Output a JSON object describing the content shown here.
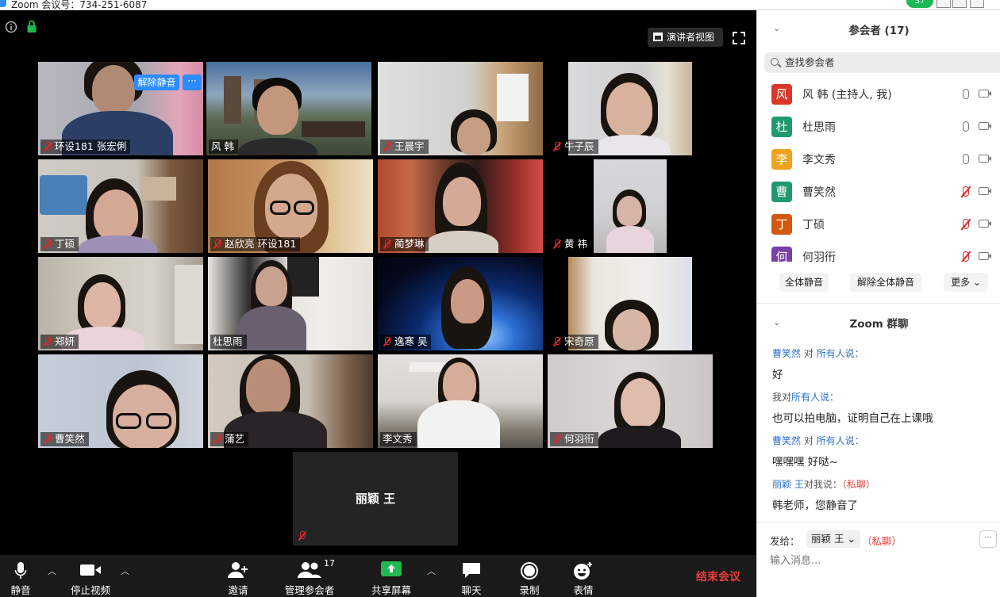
{
  "window": {
    "title": "Zoom 会议号：734-251-6087",
    "badge": "37"
  },
  "video": {
    "speaker_view_label": "演讲者视图",
    "unmute_label": "解除静音",
    "more_label": "···",
    "tiles": [
      {
        "name": "环设181 张宏俐",
        "muted": true
      },
      {
        "name": "风 韩",
        "muted": false
      },
      {
        "name": "王晨宇",
        "muted": true
      },
      {
        "name": "牛子辰",
        "muted": true
      },
      {
        "name": "丁硕",
        "muted": true
      },
      {
        "name": "赵欣亮 环设181",
        "muted": true
      },
      {
        "name": "蔺梦琳",
        "muted": true
      },
      {
        "name": "黄 祎",
        "muted": true
      },
      {
        "name": "郑妍",
        "muted": true
      },
      {
        "name": "杜思雨",
        "muted": false
      },
      {
        "name": "逸寒 吴",
        "muted": true
      },
      {
        "name": "宋奇原",
        "muted": true
      },
      {
        "name": "曹笑然",
        "muted": true
      },
      {
        "name": "蒲艺",
        "muted": true
      },
      {
        "name": "李文秀",
        "muted": false
      },
      {
        "name": "何羽衎",
        "muted": true
      }
    ],
    "no_video_tile": {
      "name": "丽颖 王",
      "muted": true
    }
  },
  "toolbar": {
    "mute": "静音",
    "stop_video": "停止视频",
    "invite": "邀请",
    "manage_participants": "管理参会者",
    "participant_count": "17",
    "share_screen": "共享屏幕",
    "chat": "聊天",
    "record": "录制",
    "reactions": "表情",
    "end_meeting": "结束会议"
  },
  "participants_panel": {
    "title": "参会者 (17)",
    "search_placeholder": "查找参会者",
    "list": [
      {
        "initial": "风",
        "name": "风 韩 (主持人, 我)",
        "color": "#d9372b",
        "muted": false
      },
      {
        "initial": "杜",
        "name": "杜思雨",
        "color": "#1e9b6b",
        "muted": false
      },
      {
        "initial": "李",
        "name": "李文秀",
        "color": "#f0a21e",
        "muted": false
      },
      {
        "initial": "曹",
        "name": "曹笑然",
        "color": "#1e9b6b",
        "muted": true
      },
      {
        "initial": "丁",
        "name": "丁硕",
        "color": "#d2590f",
        "muted": true
      },
      {
        "initial": "何",
        "name": "何羽衎",
        "color": "#7b3fa8",
        "muted": true
      }
    ],
    "mute_all": "全体静音",
    "unmute_all": "解除全体静音",
    "more": "更多 ⌄"
  },
  "chat_panel": {
    "title": "Zoom 群聊",
    "messages": [
      {
        "from": "曹笑然",
        "mid": " 对 ",
        "to": "所有人说：",
        "private": "",
        "text": "好"
      },
      {
        "from": "我",
        "mid": "对",
        "to": "所有人说：",
        "private": "",
        "text": "也可以拍电脑，证明自己在上课哦"
      },
      {
        "from": "曹笑然",
        "mid": " 对 ",
        "to": "所有人说：",
        "private": "",
        "text": "嘿嘿嘿 好哒~"
      },
      {
        "from": "丽颖 王",
        "mid": "对我说：",
        "to": "",
        "private": "（私聊）",
        "text": "韩老师，您静音了"
      }
    ],
    "send_to_label": "发给：",
    "send_to_value": "丽颖 王 ⌄",
    "send_to_private": "（私聊）",
    "more": "···",
    "input_placeholder": "输入消息..."
  }
}
